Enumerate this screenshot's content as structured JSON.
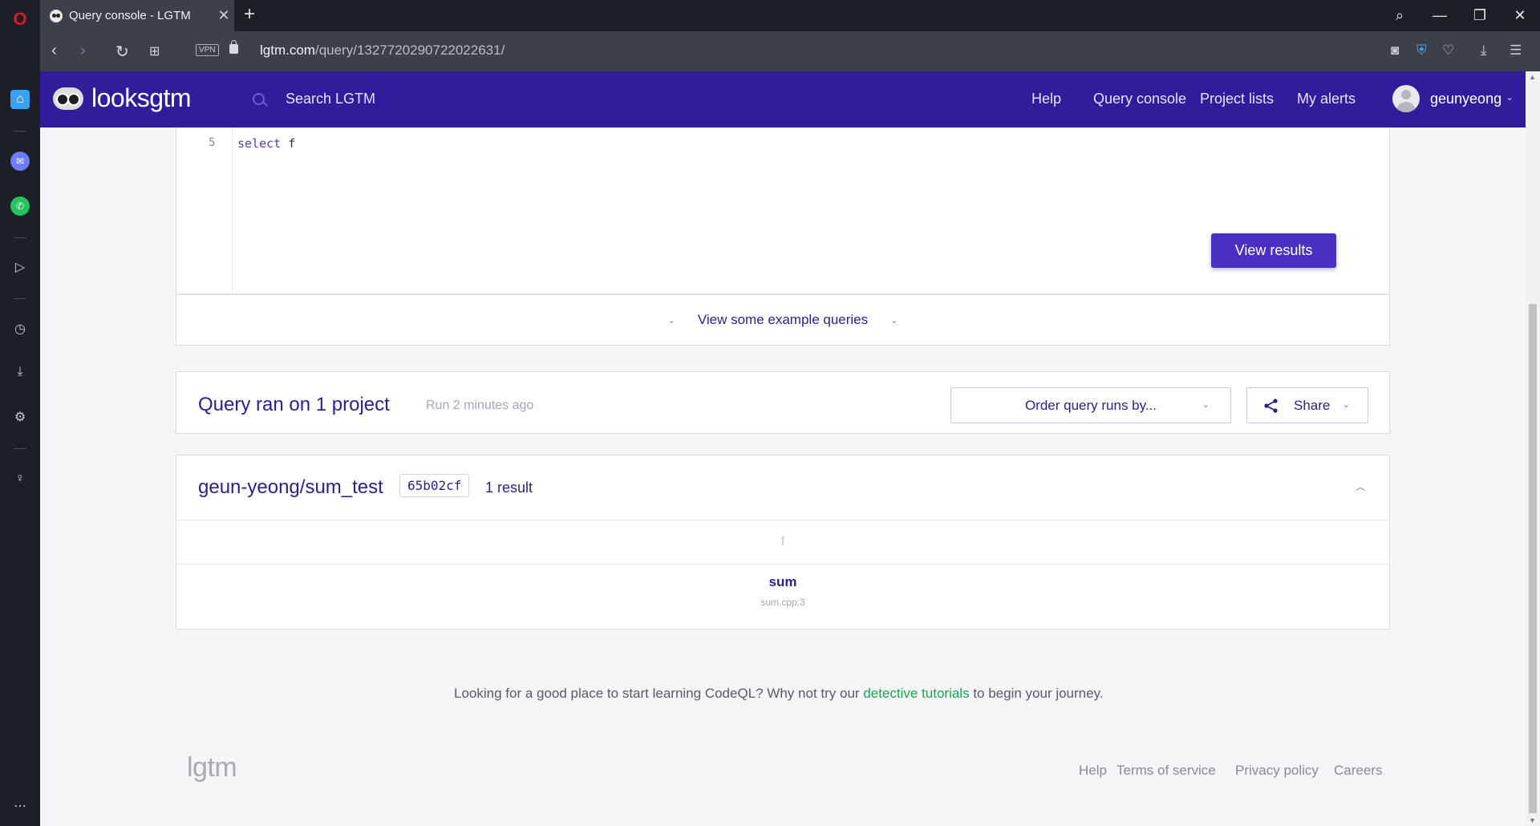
{
  "browser": {
    "tab_title": "Query console - LGTM",
    "new_tab": "+",
    "tab_close": "✕",
    "vpn": "VPN",
    "url_host": "lgtm.com",
    "url_path": "/query/1327720290722022631/"
  },
  "header": {
    "brand": "looksgtm",
    "search_placeholder": "Search LGTM",
    "nav": [
      "Help",
      "Query console",
      "Project lists",
      "My alerts"
    ],
    "username": "geunyeong"
  },
  "editor": {
    "line_number": "5",
    "code_keyword": "select",
    "code_rest": " f",
    "run_button": "View results"
  },
  "examples": {
    "label": "View some example queries"
  },
  "run": {
    "title": "Query ran on 1 project",
    "time": "Run 2 minutes ago",
    "order_label": "Order query runs by...",
    "share_label": "Share"
  },
  "result": {
    "project": "geun-yeong/sum_test",
    "commit": "65b02cf",
    "count": "1 result",
    "column": "f",
    "value": "sum",
    "location": "sum.cpp:3"
  },
  "learn": {
    "before": "Looking for a good place to start learning CodeQL? Why not try our ",
    "link": "detective tutorials",
    "after": " to begin your journey."
  },
  "footer": {
    "logo": "lgtm",
    "links": [
      "Help",
      "Terms of service",
      "Privacy policy",
      "Careers"
    ]
  }
}
